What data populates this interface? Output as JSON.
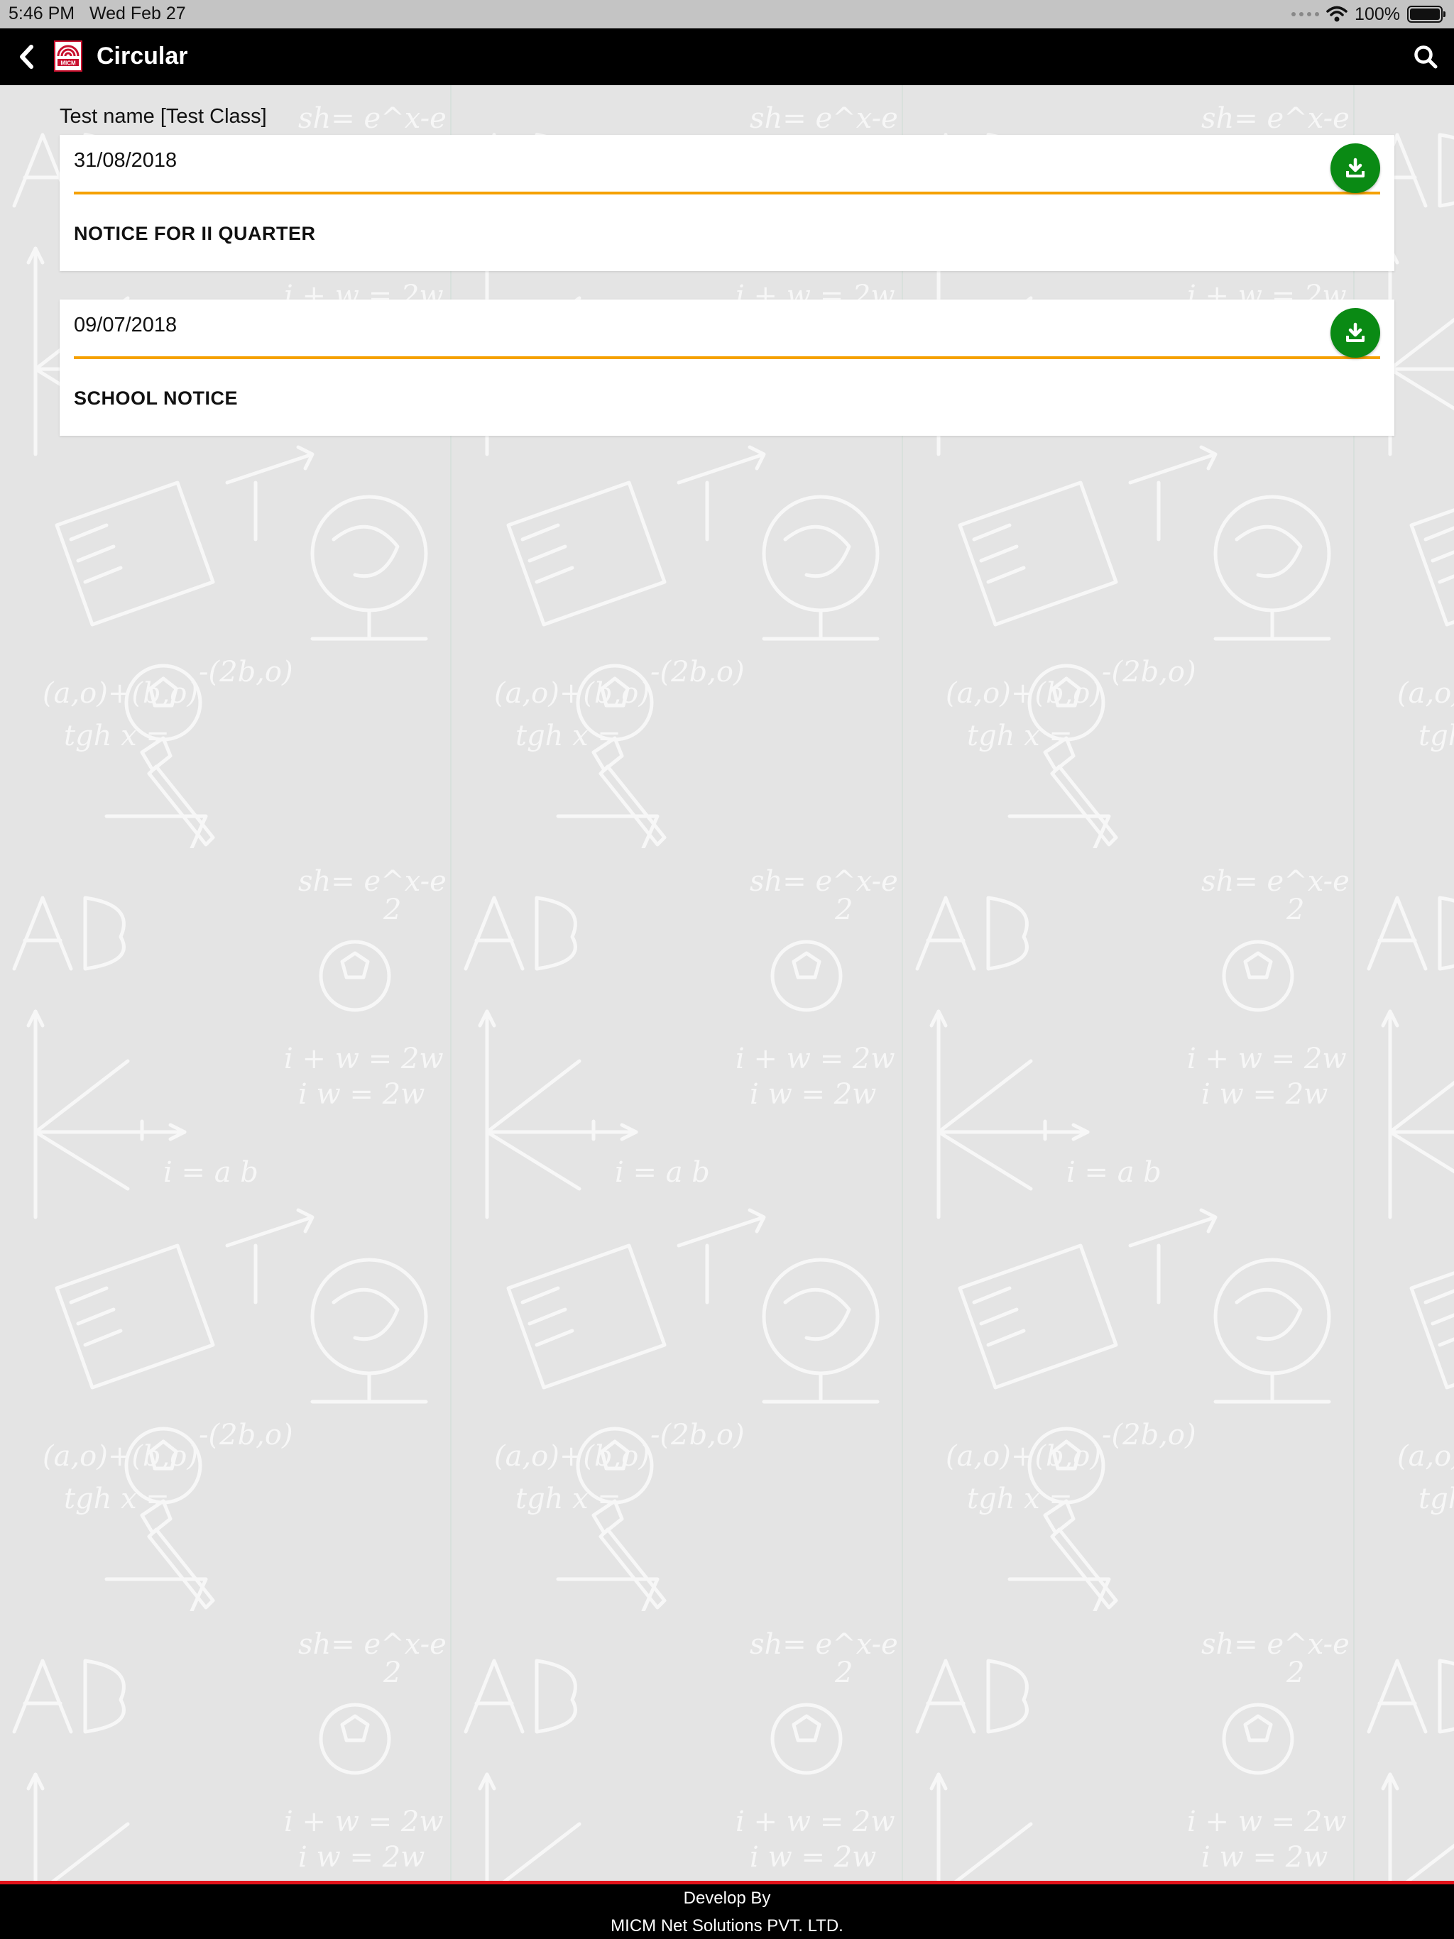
{
  "status_bar": {
    "time": "5:46 PM",
    "date": "Wed Feb 27",
    "battery": "100%",
    "battery_level": 1.0
  },
  "app_bar": {
    "title": "Circular",
    "logo_text": "MICM",
    "back_icon": "chevron-left-icon",
    "search_icon": "search-icon"
  },
  "class_label": "Test name [Test Class]",
  "circulars": [
    {
      "date": "31/08/2018",
      "title": "NOTICE FOR II QUARTER"
    },
    {
      "date": "09/07/2018",
      "title": "SCHOOL NOTICE"
    }
  ],
  "footer": {
    "line1": "Develop By",
    "line2": "MICM Net Solutions PVT. LTD."
  },
  "colors": {
    "app_bar": "#000000",
    "accent_divider": "#f5a100",
    "download_button": "#0a8a14",
    "footer_border": "#e3131b",
    "logo_red": "#c8102e"
  }
}
